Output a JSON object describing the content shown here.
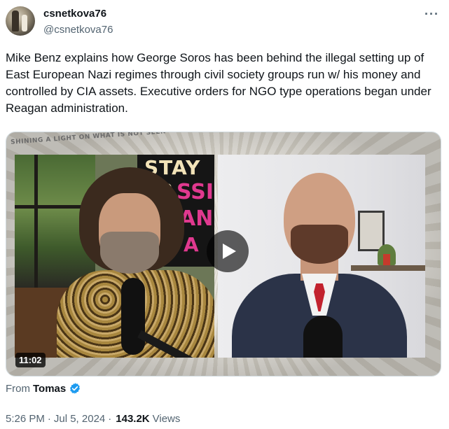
{
  "author": {
    "display_name": "csnetkova76",
    "handle": "@csnetkova76",
    "avatar_icon": "avatar-photo"
  },
  "menu": {
    "more_label": "···"
  },
  "tweet": {
    "text": "Mike Benz explains how George Soros has been behind the illegal setting up of East European Nazi regimes through civil society groups run w/ his money and controlled by CIA assets. Executive orders for NGO type operations began under Reagan administration."
  },
  "media": {
    "watermark": "SHINING A LIGHT ON WHAT IS NOT SEEN",
    "poster_lines": [
      "STAY FR",
      "SSI",
      "AN",
      "A"
    ],
    "duration": "11:02",
    "play_icon": "play-icon"
  },
  "source": {
    "prefix": "From",
    "author": "Tomas",
    "verified_icon": "verified-badge-icon",
    "badge_color": "#1d9bf0"
  },
  "meta": {
    "time": "5:26 PM",
    "separator": "·",
    "date": "Jul 5, 2024",
    "views_count": "143.2K",
    "views_label": "Views"
  },
  "colors": {
    "text_primary": "#0f1419",
    "text_secondary": "#536471",
    "border": "#cfd9de"
  }
}
